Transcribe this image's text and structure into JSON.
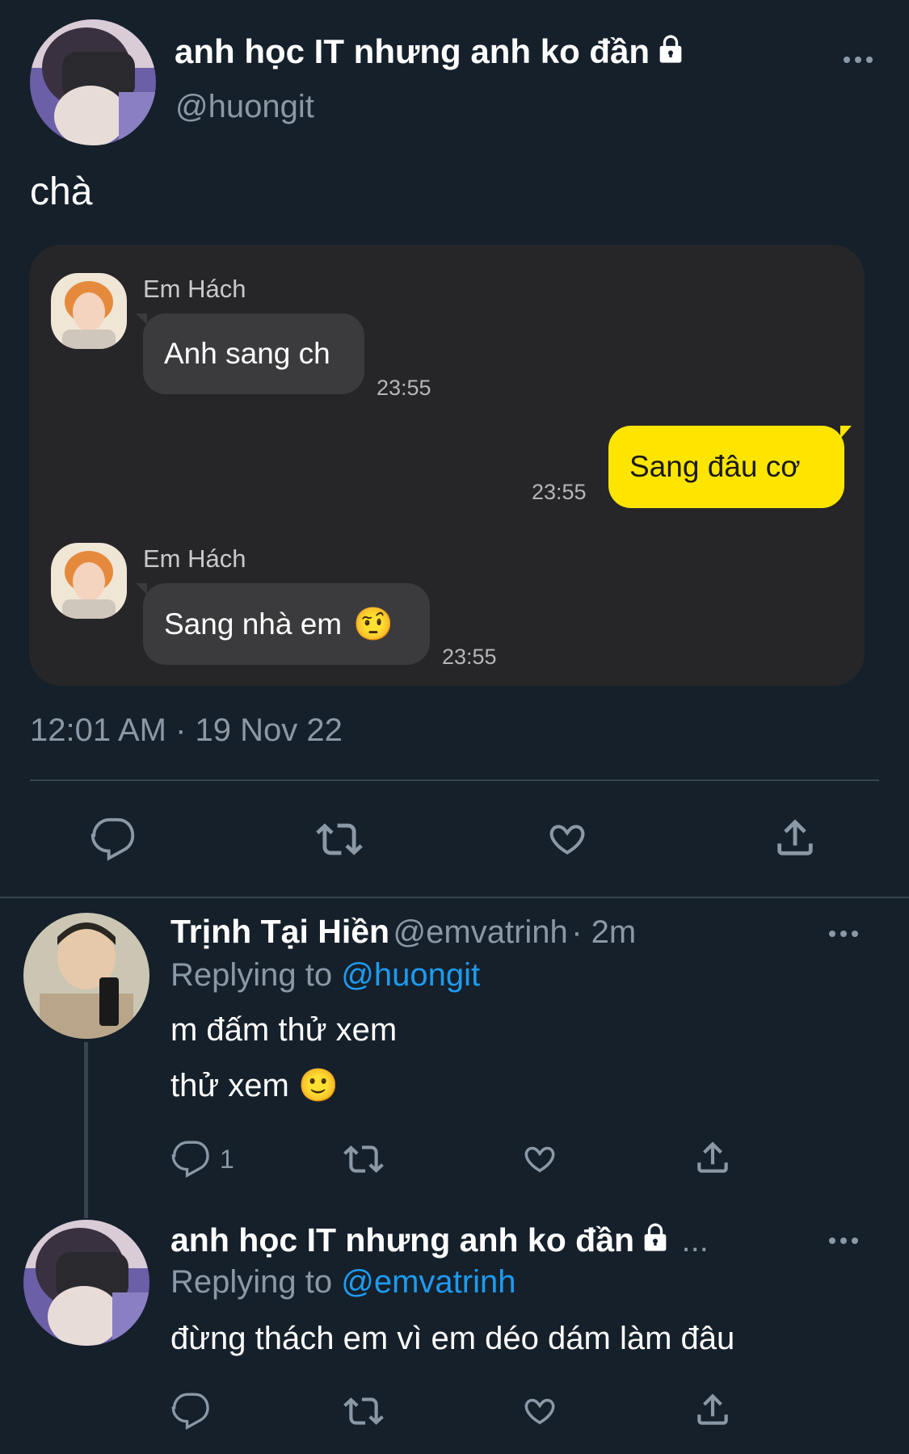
{
  "main_tweet": {
    "display_name": "anh học IT nhưng anh ko đần",
    "handle": "@huongit",
    "text": "chà",
    "timestamp": "12:01 AM · 19 Nov 22"
  },
  "chat_screenshot": {
    "messages": [
      {
        "sender": "Em Hách",
        "text": "Anh sang ch",
        "time": "23:55"
      },
      {
        "sender": "",
        "text": "Sang đâu cơ",
        "time": "23:55"
      },
      {
        "sender": "Em Hách",
        "text": "Sang nhà em",
        "emoji": "🤨",
        "time": "23:55"
      }
    ]
  },
  "replies": [
    {
      "display_name": "Trịnh Tại Hiền",
      "handle": "@emvatrinh",
      "age": "· 2m",
      "replying_prefix": "Replying to",
      "replying_to": "@huongit",
      "lines": [
        "m đấm thử xem",
        "thử xem"
      ],
      "emoji": "🙂",
      "reply_count": "1"
    },
    {
      "display_name": "anh học IT nhưng anh ko đần",
      "handle_truncated": "...",
      "replying_prefix": "Replying to",
      "replying_to": "@emvatrinh",
      "lines": [
        "đừng thách em vì em déo dám làm đâu"
      ]
    }
  ],
  "colors": {
    "background": "#15202b",
    "accent": "#1d9bf0",
    "muted": "#8b98a5",
    "kakao_yellow": "#fee500"
  },
  "icons": [
    "lock-icon",
    "more-icon",
    "reply-icon",
    "retweet-icon",
    "like-icon",
    "share-icon"
  ]
}
